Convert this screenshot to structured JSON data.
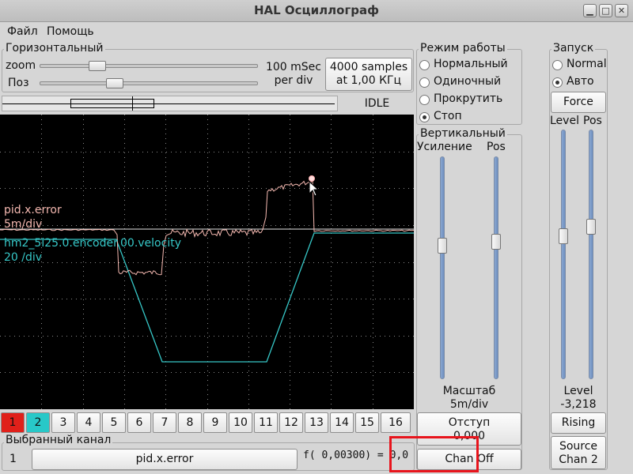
{
  "window": {
    "title": "HAL Осциллограф"
  },
  "menu": [
    "Файл",
    "Помощь"
  ],
  "horizontal": {
    "title": "Горизонтальный",
    "zoom_label": "zoom",
    "pos_label": "Поз",
    "rate": "100 mSec\nper div",
    "samples": "4000 samples\nat 1,00 КГц",
    "status": "IDLE"
  },
  "mode": {
    "title": "Режим работы",
    "options": [
      "Нормальный",
      "Одиночный",
      "Прокрутить",
      "Стоп"
    ],
    "selected": 3
  },
  "vertical": {
    "title": "Вертикальный",
    "gain_label": "Усиление",
    "pos_label": "Pos",
    "scale_title": "Масштаб",
    "scale_value": "5m/div",
    "offset_button": "Отступ\n0,000",
    "chan_off_button": "Chan Off"
  },
  "trigger": {
    "title": "Запуск",
    "options": [
      "Normal",
      "Авто"
    ],
    "selected": 1,
    "force_button": "Force",
    "level_label": "Level",
    "pos_label": "Pos",
    "level_title": "Level",
    "level_value": "-3,218",
    "edge_button": "Rising",
    "source_button": "Source\nChan  2"
  },
  "scope": {
    "ch1_name": "pid.x.error",
    "ch1_scale": "5m/div",
    "ch2_name": "hm2_5i25.0.encoder.00.velocity",
    "ch2_scale": "20 /div",
    "ch1_color": "#f4b8b0",
    "ch2_color": "#36c7c7"
  },
  "channels": [
    "1",
    "2",
    "3",
    "4",
    "5",
    "6",
    "7",
    "8",
    "9",
    "10",
    "11",
    "12",
    "13",
    "14",
    "15",
    "16"
  ],
  "selected_channel": {
    "title": "Выбранный канал",
    "number": "1",
    "name": "pid.x.error",
    "readout": "f( 0,00300) = 0,0"
  },
  "icons": {
    "minimize": "minimize-icon",
    "maximize": "maximize-icon",
    "close": "close-icon"
  }
}
